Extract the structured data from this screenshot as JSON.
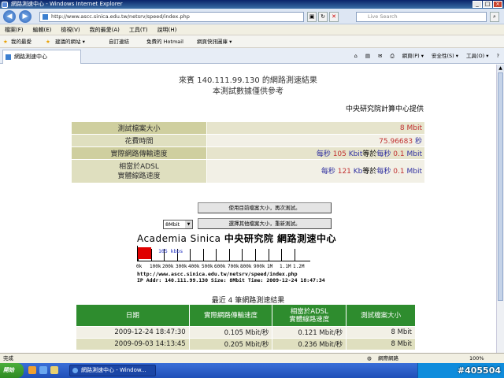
{
  "window": {
    "title": "網路測速中心 - Windows Internet Explorer"
  },
  "address": {
    "url": "http://www.ascc.sinica.edu.tw/netsrv/speed/index.php",
    "search_placeholder": "Live Search"
  },
  "menu": [
    "檔案(F)",
    "編輯(E)",
    "檢視(V)",
    "我的最愛(A)",
    "工具(T)",
    "說明(H)"
  ],
  "favorites": {
    "label": "我的最愛",
    "items": [
      "建議的網站 ▾",
      "自訂連結",
      "免費的 Hotmail",
      "網頁快訊圖庫 ▾"
    ]
  },
  "tab": {
    "label": "網路測速中心"
  },
  "tools": [
    "網頁(P) ▾",
    "安全性(S) ▾",
    "工具(O) ▾"
  ],
  "page": {
    "heading1": "來賓 140.111.99.130 的網路測速結果",
    "heading2": "本測試數據僅供參考",
    "provider": "中央研究院計算中心提供",
    "rows": [
      {
        "label": "測試檔案大小",
        "value": [
          {
            "t": "8 Mbit",
            "c": "red"
          }
        ]
      },
      {
        "label": "花費時間",
        "value": [
          {
            "t": "75.96683",
            "c": "red"
          },
          {
            "t": " 秒",
            "c": "blue"
          }
        ]
      },
      {
        "label": "實際網路傳輸速度",
        "value": [
          {
            "t": "每秒 ",
            "c": "blue"
          },
          {
            "t": "105",
            "c": "red"
          },
          {
            "t": " Kbit",
            "c": "blue"
          },
          {
            "t": "等於",
            "c": ""
          },
          {
            "t": "每秒 ",
            "c": "blue"
          },
          {
            "t": "0.1",
            "c": "red"
          },
          {
            "t": " Mbit",
            "c": "blue"
          }
        ]
      },
      {
        "label": "相當於ADSL 實體線路速度",
        "value": [
          {
            "t": "每秒 ",
            "c": "blue"
          },
          {
            "t": "121",
            "c": "red"
          },
          {
            "t": " Kb",
            "c": "blue"
          },
          {
            "t": "等於",
            "c": ""
          },
          {
            "t": "每秒 ",
            "c": "blue"
          },
          {
            "t": "0.1",
            "c": "red"
          },
          {
            "t": " Mbit",
            "c": "blue"
          }
        ]
      }
    ],
    "btn_retest": "使用目前檔案大小，再次測試。",
    "btn_other": "選擇其他檔案大小，重新測試。",
    "size_select": "8Mbit",
    "banner_en": "Academia Sinica",
    "banner_zh": "中央研究院 網路測速中心",
    "speed_label": "105 kbps",
    "speed_fraction": 0.0875,
    "ticks": [
      "0k",
      "100k",
      "200k",
      "300k",
      "400k",
      "500k",
      "600k",
      "700k",
      "800k",
      "900k",
      "1M",
      "1.1M",
      "1.2M"
    ],
    "info1": "http://www.ascc.sinica.edu.tw/netsrv/speed/index.php",
    "info2": "IP Addr: 140.111.99.130 Size: 8Mbit Time: 2009-12-24 18:47:34",
    "recent_title": "最近 4 筆網路測速結果",
    "hist_headers": [
      "日期",
      "實際網路傳輸速度",
      "相當於ADSL\n實體線路速度",
      "測試檔案大小"
    ],
    "hist_rows": [
      [
        "2009-12-24 18:47:30",
        "0.105 Mbit/秒",
        "0.121 Mbit/秒",
        "8 Mbit"
      ],
      [
        "2009-09-03 14:13:45",
        "0.205 Mbit/秒",
        "0.236 Mbit/秒",
        "8 Mbit"
      ]
    ]
  },
  "status": {
    "left": "完成",
    "zone": "網際網路",
    "zoom": "100%"
  },
  "taskbar": {
    "start": "開始",
    "item": "網路測速中心 - Window...",
    "watermark": "#405504"
  }
}
